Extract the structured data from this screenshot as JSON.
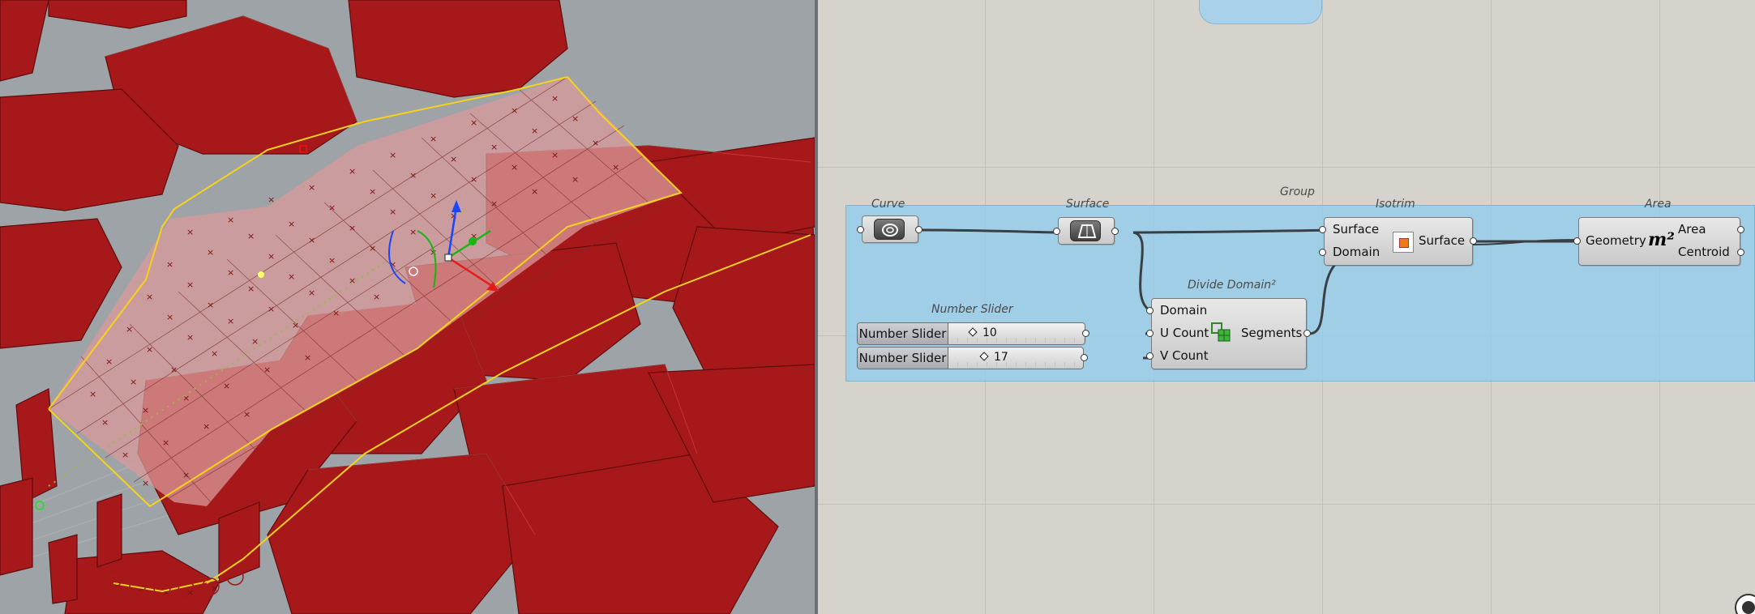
{
  "canvas": {
    "group_label": "Group",
    "components": {
      "curve": {
        "title": "Curve",
        "icon": "curve-param-icon"
      },
      "surface": {
        "title": "Surface",
        "icon": "surface-param-icon"
      },
      "isotrim": {
        "title": "Isotrim",
        "inputs": [
          "Surface",
          "Domain"
        ],
        "outputs": [
          "Surface"
        ],
        "icon": "isotrim-icon"
      },
      "area": {
        "title": "Area",
        "inputs": [
          "Geometry"
        ],
        "outputs": [
          "Area",
          "Centroid"
        ],
        "icon_text": "m²"
      },
      "divide_domain": {
        "title": "Divide Domain²",
        "inputs": [
          "Domain",
          "U Count",
          "V Count"
        ],
        "outputs": [
          "Segments"
        ],
        "icon": "divide-domain-icon"
      },
      "number_slider_group": {
        "title": "Number Slider",
        "sliders": [
          {
            "label": "Number Slider",
            "value": "10",
            "fraction": 0.1
          },
          {
            "label": "Number Slider",
            "value": "17",
            "fraction": 0.2
          }
        ]
      }
    }
  },
  "colors": {
    "group_fill": "#98cdeb",
    "wire": "#3a3f44",
    "building_red": "#b30f0f",
    "curve_yellow": "#f6d21a"
  }
}
